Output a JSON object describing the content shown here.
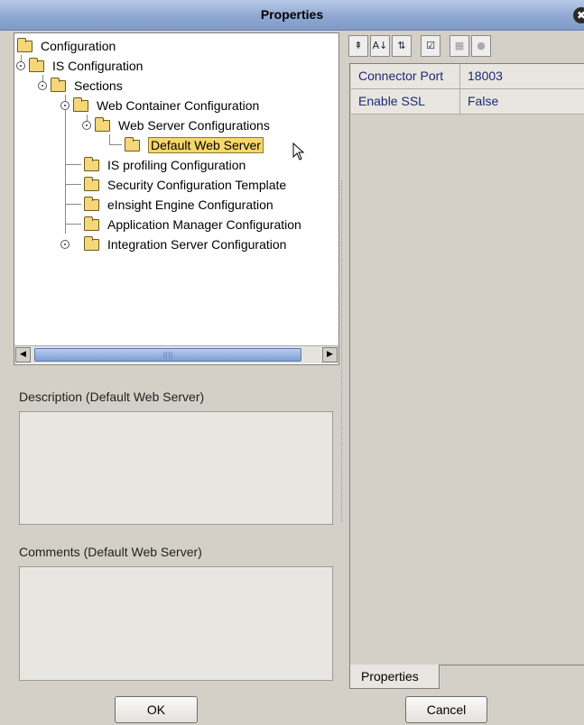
{
  "window": {
    "title": "Properties",
    "close_icon": "✖"
  },
  "tree": {
    "items": [
      {
        "label": "Configuration"
      },
      {
        "label": "IS Configuration"
      },
      {
        "label": "Sections"
      },
      {
        "label": "Web Container Configuration"
      },
      {
        "label": "Web Server Configurations"
      },
      {
        "label": "Default Web Server"
      },
      {
        "label": "IS profiling Configuration"
      },
      {
        "label": "Security Configuration Template"
      },
      {
        "label": "eInsight Engine Configuration"
      },
      {
        "label": "Application Manager Configuration"
      },
      {
        "label": "Integration Server Configuration"
      }
    ]
  },
  "scrollbar": {
    "left_arrow": "◀",
    "right_arrow": "▶",
    "grip": "||||"
  },
  "description": {
    "label": "Description (Default Web Server)",
    "value": ""
  },
  "comments": {
    "label": "Comments (Default Web Server)",
    "value": ""
  },
  "toolbar": {
    "buttons": [
      {
        "icon": "expand-icon",
        "glyph": "⇞"
      },
      {
        "icon": "sort-az-icon",
        "glyph": "A↓"
      },
      {
        "icon": "sort-categories-icon",
        "glyph": "⇅"
      },
      {
        "icon": "checklist-icon",
        "glyph": "☑"
      },
      {
        "icon": "grid-icon",
        "glyph": "▦"
      },
      {
        "icon": "help-icon",
        "glyph": "●"
      }
    ]
  },
  "properties": {
    "rows": [
      {
        "key": "Connector Port",
        "value": "18003"
      },
      {
        "key": "Enable SSL",
        "value": "False"
      }
    ]
  },
  "tabs": {
    "properties": "Properties"
  },
  "buttons": {
    "ok": "OK",
    "cancel": "Cancel"
  },
  "colors": {
    "selection": "#f8d66a",
    "prop_text": "#1b2a7a",
    "title_bar": "#8fa8d3"
  }
}
